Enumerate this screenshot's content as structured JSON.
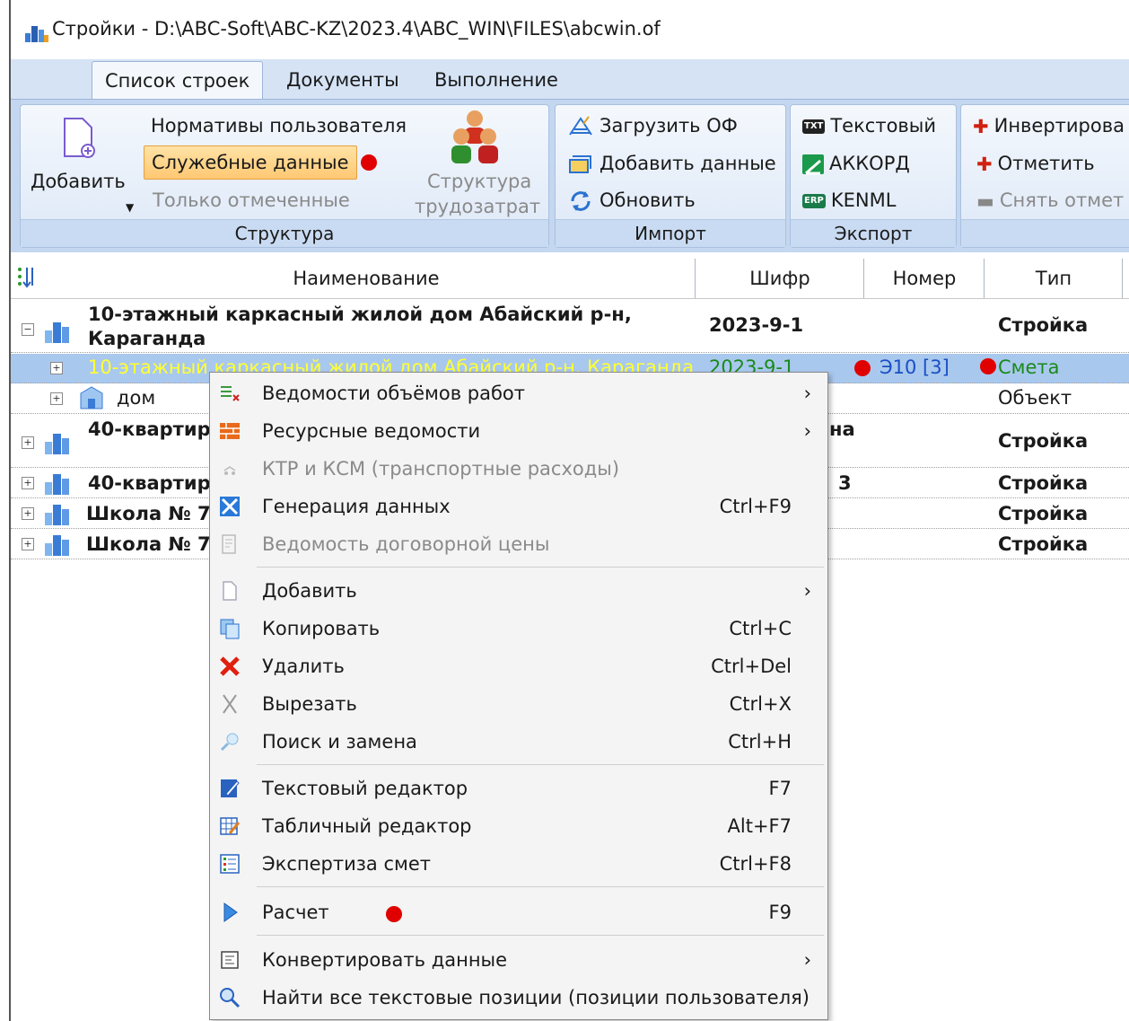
{
  "window": {
    "title": "Стройки - D:\\ABC-Soft\\ABC-KZ\\2023.4\\ABC_WIN\\FILES\\abcwin.of"
  },
  "ribbon": {
    "tabs": [
      "Список строек",
      "Документы",
      "Выполнение"
    ],
    "structure": {
      "label": "Структура",
      "add": "Добавить",
      "user_norms": "Нормативы пользователя",
      "service_data": "Служебные данные",
      "only_marked": "Только отмеченные",
      "labor_structure_1": "Структура",
      "labor_structure_2": "трудозатрат"
    },
    "import": {
      "label": "Импорт",
      "load_of": "Загрузить ОФ",
      "add_data": "Добавить данные",
      "refresh": "Обновить"
    },
    "export": {
      "label": "Экспорт",
      "text": "Текстовый",
      "akkord": "АККОРД",
      "kenml": "KENML"
    },
    "mark": {
      "invert": "Инвертирова",
      "mark": "Отметить",
      "unmark": "Снять отмет"
    }
  },
  "grid": {
    "headers": {
      "name": "Наименование",
      "code": "Шифр",
      "number": "Номер",
      "type": "Тип"
    },
    "rows": [
      {
        "name1": "10-этажный каркасный жилой дом Абайский р-н,",
        "name2": "Караганда",
        "code": "2023-9-1",
        "number": "",
        "type": "Стройка"
      },
      {
        "name": "10-этажный каркасный жилой дом Абайский р-н, Караганда",
        "code": "2023-9-1",
        "number": "Э10 [3]",
        "type": "Смета"
      },
      {
        "name": "дом",
        "code": "",
        "number": "",
        "type": "Объект"
      },
      {
        "name": "40-квартир",
        "code": "на",
        "number": "",
        "type": "Стройка"
      },
      {
        "name": "40-квартир",
        "code": "3",
        "number": "",
        "type": "Стройка"
      },
      {
        "name": "Школа № 7",
        "code": "",
        "number": "",
        "type": "Стройка"
      },
      {
        "name": "Школа № 7",
        "code": "",
        "number": "",
        "type": "Стройка"
      }
    ]
  },
  "context_menu": {
    "items": [
      {
        "label": "Ведомости объёмов работ",
        "shortcut": "",
        "submenu": true,
        "icon": "volumes-icon"
      },
      {
        "label": "Ресурсные ведомости",
        "shortcut": "",
        "submenu": true,
        "icon": "bricks-icon"
      },
      {
        "label": "КТР и КСМ (транспортные расходы)",
        "shortcut": "",
        "disabled": true,
        "icon": "transport-icon"
      },
      {
        "label": "Генерация данных",
        "shortcut": "Ctrl+F9",
        "icon": "generate-icon"
      },
      {
        "label": "Ведомость договорной цены",
        "shortcut": "",
        "disabled": true,
        "icon": "contract-price-icon"
      },
      {
        "label": "Добавить",
        "shortcut": "",
        "submenu": true,
        "icon": "add-doc-icon"
      },
      {
        "label": "Копировать",
        "shortcut": "Ctrl+C",
        "icon": "copy-icon"
      },
      {
        "label": "Удалить",
        "shortcut": "Ctrl+Del",
        "icon": "delete-icon"
      },
      {
        "label": "Вырезать",
        "shortcut": "Ctrl+X",
        "icon": "cut-icon"
      },
      {
        "label": "Поиск и замена",
        "shortcut": "Ctrl+H",
        "icon": "find-replace-icon"
      },
      {
        "label": "Текстовый редактор",
        "shortcut": "F7",
        "icon": "text-editor-icon"
      },
      {
        "label": "Табличный редактор",
        "shortcut": "Alt+F7",
        "icon": "table-editor-icon"
      },
      {
        "label": "Экспертиза смет",
        "shortcut": "Ctrl+F8",
        "icon": "expertise-icon"
      },
      {
        "label": "Расчет",
        "shortcut": "F9",
        "icon": "play-icon"
      },
      {
        "label": "Конвертировать данные",
        "shortcut": "",
        "submenu": true,
        "icon": "convert-icon"
      },
      {
        "label": "Найти все текстовые позиции (позиции пользователя)",
        "shortcut": "",
        "icon": "search-icon"
      }
    ],
    "submenu_arrow": "›"
  },
  "colors": {
    "accent_red": "#e00000",
    "selection": "#a9c8ee",
    "highlight_text": "#ffff33",
    "estimate_green": "#1a8a1a",
    "number_blue": "#1a4fc4"
  }
}
